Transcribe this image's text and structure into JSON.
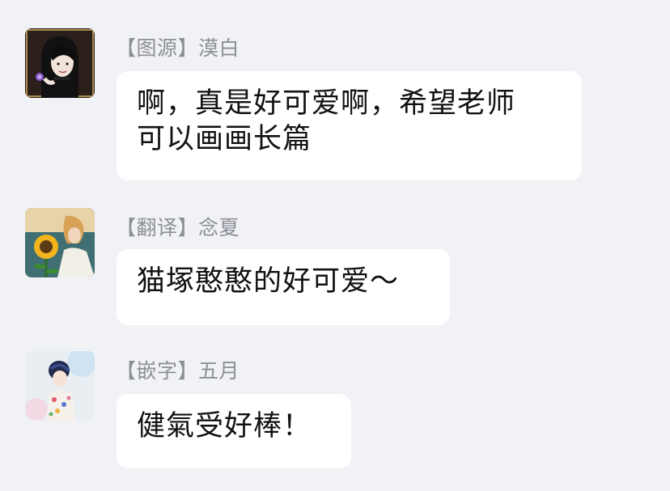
{
  "messages": [
    {
      "sender": "【图源】漠白",
      "lines": [
        "啊，真是好可爱啊，希望老师",
        "可以画画长篇"
      ]
    },
    {
      "sender": "【翻译】念夏",
      "lines": [
        "猫塚憨憨的好可爱～"
      ]
    },
    {
      "sender": "【嵌字】五月",
      "lines": [
        "健氣受好棒！"
      ]
    }
  ]
}
